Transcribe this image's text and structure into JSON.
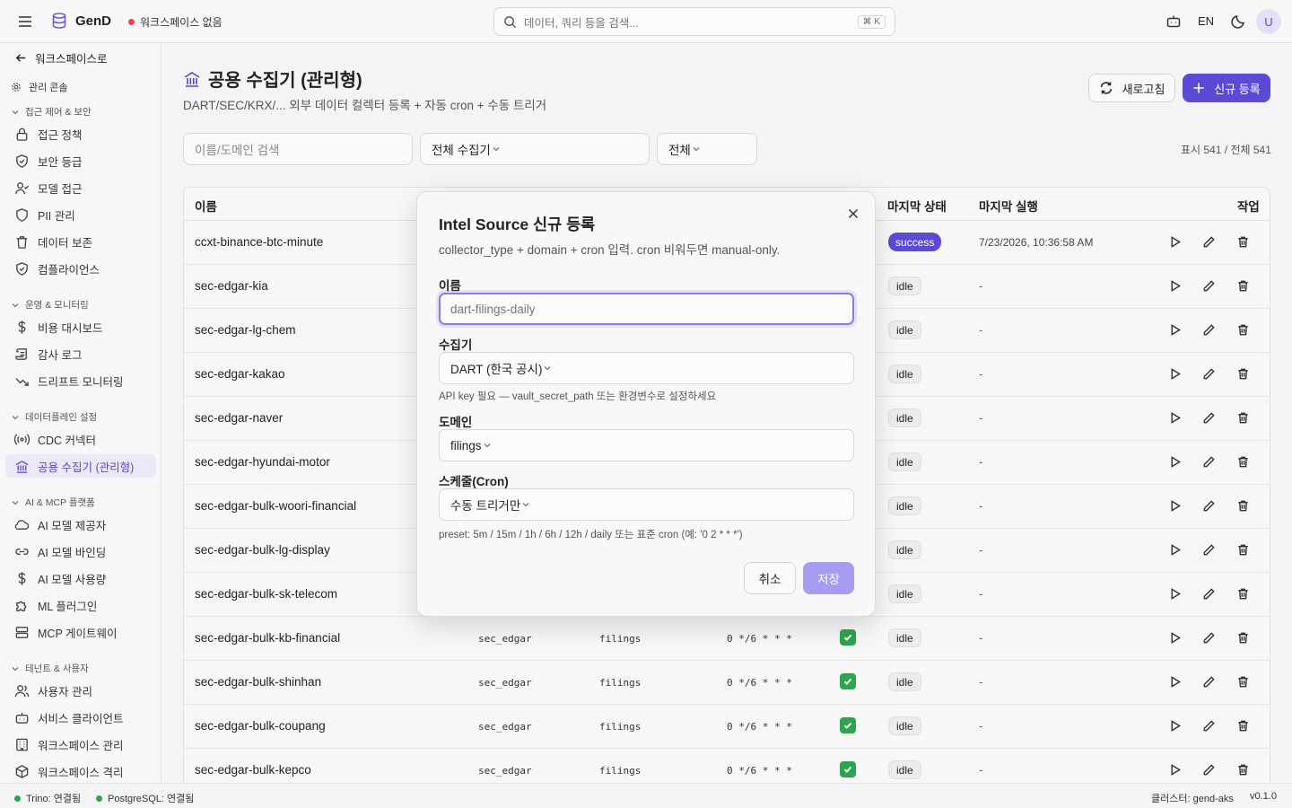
{
  "topbar": {
    "brand": "GenD",
    "workspace_status": "워크스페이스 없음",
    "search_placeholder": "데이터, 쿼리 등을 검색...",
    "search_shortcut": "⌘ K",
    "lang": "EN",
    "avatar_initial": "U"
  },
  "sidebar": {
    "back_label": "워크스페이스로",
    "admin_label": "관리 콘솔",
    "sections": [
      {
        "title": "접근 제어 & 보안",
        "items": [
          "접근 정책",
          "보안 등급",
          "모델 접근",
          "PII 관리",
          "데이터 보존",
          "컴플라이언스"
        ]
      },
      {
        "title": "운영 & 모니터링",
        "items": [
          "비용 대시보드",
          "감사 로그",
          "드리프트 모니터링"
        ]
      },
      {
        "title": "데이터플레인 설정",
        "items": [
          "CDC 커넥터",
          "공용 수집기 (관리형)"
        ]
      },
      {
        "title": "AI & MCP 플랫폼",
        "items": [
          "AI 모델 제공자",
          "AI 모델 바인딩",
          "AI 모델 사용량",
          "ML 플러그인",
          "MCP 게이트웨이"
        ]
      },
      {
        "title": "테넌트 & 사용자",
        "items": [
          "사용자 관리",
          "서비스 클라이언트",
          "워크스페이스 관리",
          "워크스페이스 격리"
        ]
      }
    ]
  },
  "statusbar": {
    "trino": "Trino: 연결됨",
    "postgres": "PostgreSQL: 연결됨",
    "cluster": "클러스터: gend-aks",
    "version": "v0.1.0"
  },
  "page": {
    "title": "공용 수집기 (관리형)",
    "subtitle": "DART/SEC/KRX/... 외부 데이터 컬렉터 등록 + 자동 cron + 수동 트리거",
    "refresh_label": "새로고침",
    "new_label": "신규 등록",
    "filter_search_placeholder": "이름/도메인 검색",
    "filter_collector": "전체 수집기",
    "filter_status": "전체",
    "count": "표시 541 / 전체 541"
  },
  "table": {
    "headers": {
      "name": "이름",
      "last_status": "마지막 상태",
      "last_run": "마지막 실행",
      "actions": "작업"
    },
    "rows": [
      {
        "name": "ccxt-binance-btc-minute",
        "collector": "",
        "domain": "",
        "cron": "",
        "enabled": false,
        "status": "success",
        "last_run": "7/23/2026, 10:36:58 AM"
      },
      {
        "name": "sec-edgar-kia",
        "collector": "",
        "domain": "",
        "cron": "",
        "enabled": false,
        "status": "idle",
        "last_run": "-"
      },
      {
        "name": "sec-edgar-lg-chem",
        "collector": "",
        "domain": "",
        "cron": "",
        "enabled": false,
        "status": "idle",
        "last_run": "-"
      },
      {
        "name": "sec-edgar-kakao",
        "collector": "",
        "domain": "",
        "cron": "",
        "enabled": false,
        "status": "idle",
        "last_run": "-"
      },
      {
        "name": "sec-edgar-naver",
        "collector": "",
        "domain": "",
        "cron": "",
        "enabled": false,
        "status": "idle",
        "last_run": "-"
      },
      {
        "name": "sec-edgar-hyundai-motor",
        "collector": "",
        "domain": "",
        "cron": "",
        "enabled": false,
        "status": "idle",
        "last_run": "-"
      },
      {
        "name": "sec-edgar-bulk-woori-financial",
        "collector": "",
        "domain": "",
        "cron": "",
        "enabled": false,
        "status": "idle",
        "last_run": "-"
      },
      {
        "name": "sec-edgar-bulk-lg-display",
        "collector": "",
        "domain": "",
        "cron": "",
        "enabled": false,
        "status": "idle",
        "last_run": "-"
      },
      {
        "name": "sec-edgar-bulk-sk-telecom",
        "collector": "",
        "domain": "",
        "cron": "",
        "enabled": false,
        "status": "idle",
        "last_run": "-"
      },
      {
        "name": "sec-edgar-bulk-kb-financial",
        "collector": "sec_edgar",
        "domain": "filings",
        "cron": "0 */6 * * *",
        "enabled": true,
        "status": "idle",
        "last_run": "-"
      },
      {
        "name": "sec-edgar-bulk-shinhan",
        "collector": "sec_edgar",
        "domain": "filings",
        "cron": "0 */6 * * *",
        "enabled": true,
        "status": "idle",
        "last_run": "-"
      },
      {
        "name": "sec-edgar-bulk-coupang",
        "collector": "sec_edgar",
        "domain": "filings",
        "cron": "0 */6 * * *",
        "enabled": true,
        "status": "idle",
        "last_run": "-"
      },
      {
        "name": "sec-edgar-bulk-kepco",
        "collector": "sec_edgar",
        "domain": "filings",
        "cron": "0 */6 * * *",
        "enabled": true,
        "status": "idle",
        "last_run": "-"
      }
    ]
  },
  "modal": {
    "title": "Intel Source 신규 등록",
    "description": "collector_type + domain + cron 입력. cron 비워두면 manual-only.",
    "name_label": "이름",
    "name_placeholder": "dart-filings-daily",
    "collector_label": "수집기",
    "collector_value": "DART (한국 공시)",
    "collector_hint": "API key 필요 — vault_secret_path 또는 환경변수로 설정하세요",
    "domain_label": "도메인",
    "domain_value": "filings",
    "cron_label": "스케줄(Cron)",
    "cron_value": "수동 트리거만",
    "cron_hint": "preset: 5m / 15m / 1h / 6h / 12h / daily 또는 표준 cron (예: '0 2 * * *')",
    "cancel_label": "취소",
    "save_label": "저장"
  }
}
